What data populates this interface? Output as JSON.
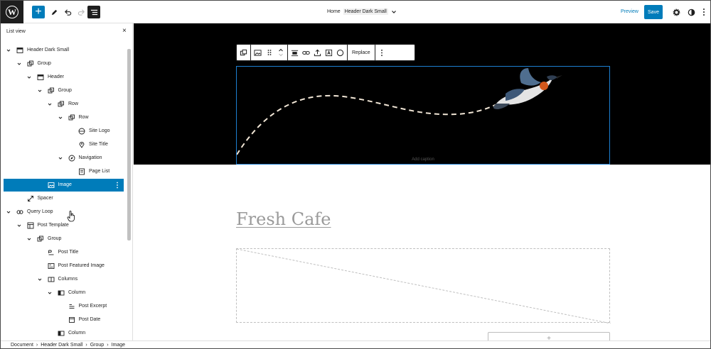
{
  "topbar": {
    "logo_glyph": "W",
    "add_label": "+",
    "breadcrumb_home": "Home",
    "breadcrumb_template": "Header Dark Small",
    "preview_label": "Preview",
    "save_label": "Save"
  },
  "sidebar": {
    "title": "List view",
    "close_glyph": "×",
    "items": [
      {
        "label": "Header Dark Small",
        "icon": "template-part-icon",
        "level": 0,
        "expanded": true
      },
      {
        "label": "Group",
        "icon": "group-icon",
        "level": 1,
        "expanded": true
      },
      {
        "label": "Header",
        "icon": "template-part-icon",
        "level": 2,
        "expanded": true
      },
      {
        "label": "Group",
        "icon": "group-icon",
        "level": 3,
        "expanded": true
      },
      {
        "label": "Row",
        "icon": "group-icon",
        "level": 4,
        "expanded": true
      },
      {
        "label": "Row",
        "icon": "group-icon",
        "level": 5,
        "expanded": true
      },
      {
        "label": "Site Logo",
        "icon": "site-logo-icon",
        "level": 6
      },
      {
        "label": "Site Title",
        "icon": "map-marker-icon",
        "level": 6
      },
      {
        "label": "Navigation",
        "icon": "compass-icon",
        "level": 5,
        "expanded": true
      },
      {
        "label": "Page List",
        "icon": "page-list-icon",
        "level": 6
      },
      {
        "label": "Image",
        "icon": "image-icon",
        "level": 3,
        "selected": true
      },
      {
        "label": "Spacer",
        "icon": "resize-icon",
        "level": 1
      },
      {
        "label": "Query Loop",
        "icon": "loop-icon",
        "level": 0,
        "expanded": true
      },
      {
        "label": "Post Template",
        "icon": "layout-icon",
        "level": 1,
        "expanded": true
      },
      {
        "label": "Group",
        "icon": "group-icon",
        "level": 2,
        "expanded": true
      },
      {
        "label": "Post Title",
        "icon": "title-icon",
        "level": 3
      },
      {
        "label": "Post Featured Image",
        "icon": "featured-image-icon",
        "level": 3
      },
      {
        "label": "Columns",
        "icon": "columns-icon",
        "level": 3,
        "expanded": true
      },
      {
        "label": "Column",
        "icon": "column-icon",
        "level": 4,
        "expanded": true
      },
      {
        "label": "Post Excerpt",
        "icon": "excerpt-icon",
        "level": 5
      },
      {
        "label": "Post Date",
        "icon": "calendar-icon",
        "level": 5
      },
      {
        "label": "Column",
        "icon": "column-icon",
        "level": 4
      }
    ]
  },
  "canvas": {
    "toolbar_replace": "Replace",
    "image_caption_placeholder": "Add caption",
    "site_title": "Fresh Cafe",
    "button_stub": "+"
  },
  "footer": {
    "crumbs": [
      "Document",
      "Header Dark Small",
      "Group",
      "Image"
    ],
    "separator": "›"
  },
  "colors": {
    "accent": "#007cba",
    "dark": "#1e1e1e",
    "selection_outline": "#1d7fd1"
  }
}
